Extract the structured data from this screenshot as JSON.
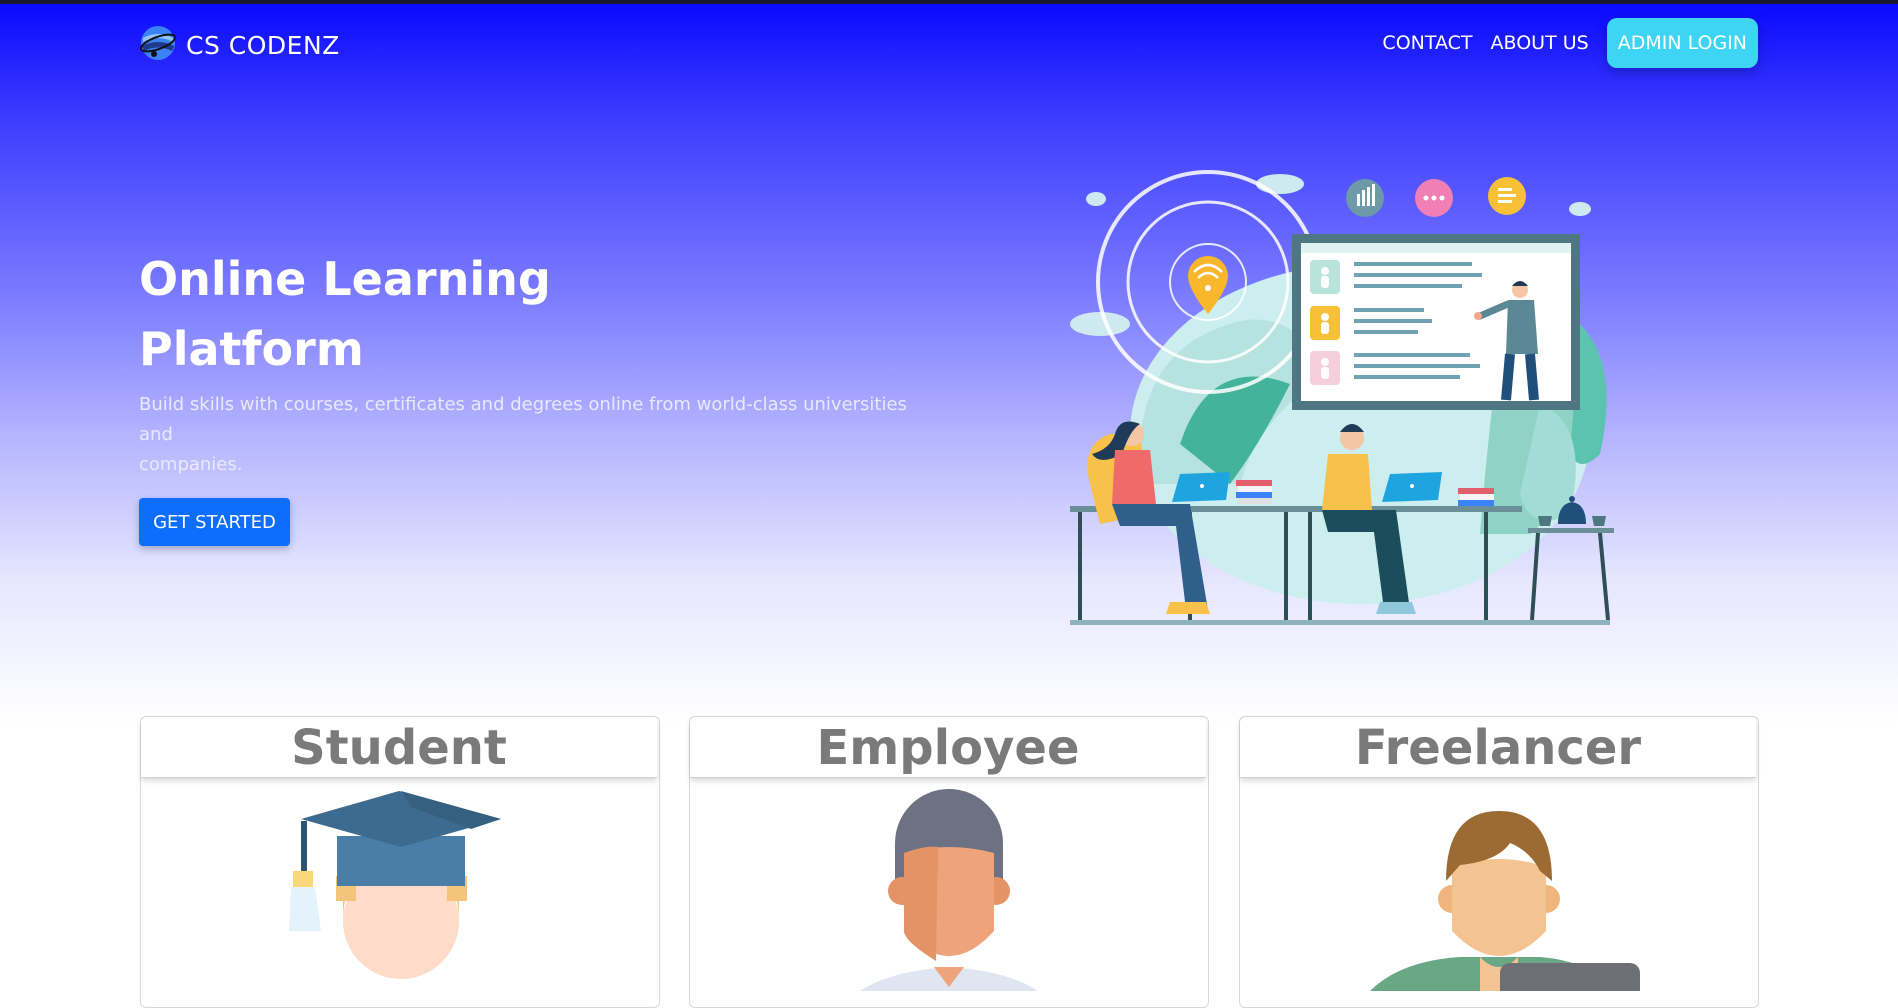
{
  "nav": {
    "brand": "CS CODENZ",
    "links": [
      "CONTACT",
      "ABOUT US"
    ],
    "admin_label": "ADMIN LOGIN"
  },
  "hero": {
    "title_line1": "Online Learning",
    "title_line2": "Platform",
    "subtitle_line1": "Build skills with courses, certificates and degrees online from world-class universities and",
    "subtitle_line2": "companies.",
    "cta_label": "GET STARTED"
  },
  "cards": [
    {
      "title": "Student",
      "icon": "graduate-avatar-icon"
    },
    {
      "title": "Employee",
      "icon": "employee-avatar-icon"
    },
    {
      "title": "Freelancer",
      "icon": "freelancer-avatar-icon"
    }
  ],
  "colors": {
    "hero_top": "#0a0aff",
    "admin_button": "#3dd5f3",
    "cta_button": "#0d6efd",
    "card_title": "#7a7a7a"
  }
}
